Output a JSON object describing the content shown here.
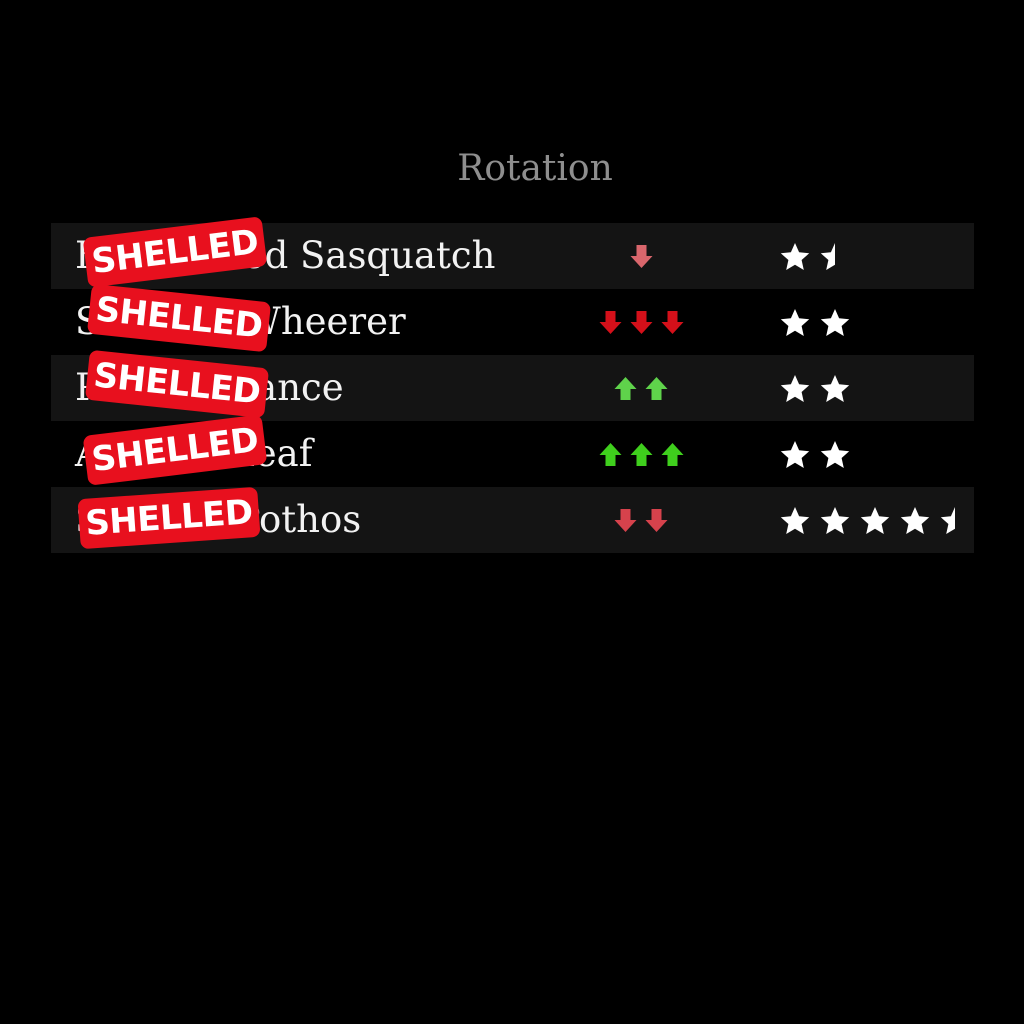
{
  "title": "Rotation",
  "rows": [
    {
      "name": "Bewildered Sasquatch",
      "stamp": "SHELLED",
      "trend": {
        "direction": "down",
        "count": 1,
        "color": "#d9666c"
      },
      "rating": 1.5
    },
    {
      "name": "Scentful Wheerer",
      "stamp": "SHELLED",
      "trend": {
        "direction": "down",
        "count": 3,
        "color": "#d4101a"
      },
      "rating": 2
    },
    {
      "name": "Purse Balance",
      "stamp": "SHELLED",
      "trend": {
        "direction": "up",
        "count": 2,
        "color": "#5fd34b"
      },
      "rating": 2
    },
    {
      "name": "Almond Leaf",
      "stamp": "SHELLED",
      "trend": {
        "direction": "up",
        "count": 3,
        "color": "#3fcf1d"
      },
      "rating": 2
    },
    {
      "name": "Shadow Pothos",
      "stamp": "SHELLED",
      "trend": {
        "direction": "down",
        "count": 2,
        "color": "#d6424c"
      },
      "rating": 4.5
    }
  ],
  "colors": {
    "background": "#000000",
    "row_stripe": "#141414",
    "stamp": "#e8101e",
    "star": "#ffffff"
  }
}
